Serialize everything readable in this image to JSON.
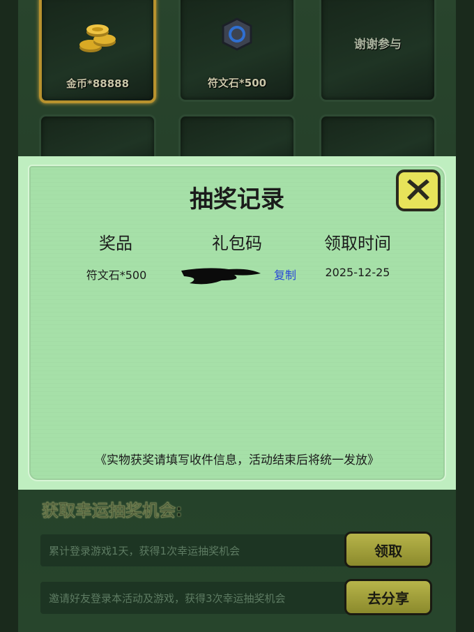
{
  "prize_grid": {
    "cells": [
      {
        "label": "金币*88888",
        "icon": "gold-coins-icon"
      },
      {
        "label": "符文石*500",
        "icon": "rune-stone-icon"
      },
      {
        "label": "谢谢参与",
        "icon": ""
      }
    ]
  },
  "record_modal": {
    "title": "抽奖记录",
    "close_icon": "close-icon",
    "headers": [
      "奖品",
      "礼包码",
      "领取时间"
    ],
    "rows": [
      {
        "prize": "符文石*500",
        "code": "",
        "copy_label": "复制",
        "time": "2025-12-25"
      }
    ],
    "footnote": "《实物获奖请填写收件信息，活动结束后将统一发放》"
  },
  "chances": {
    "title": "获取幸运抽奖机会:",
    "tasks": [
      {
        "text": "累计登录游戏1天，获得1次幸运抽奖机会",
        "button": "领取"
      },
      {
        "text": "邀请好友登录本活动及游戏，获得3次幸运抽奖机会",
        "button": "去分享"
      }
    ]
  },
  "colors": {
    "accent_gold": "#b8922e",
    "modal_bg": "#bfeec0",
    "copy_link": "#2847d8",
    "button_yellow": "#e7e35a"
  }
}
